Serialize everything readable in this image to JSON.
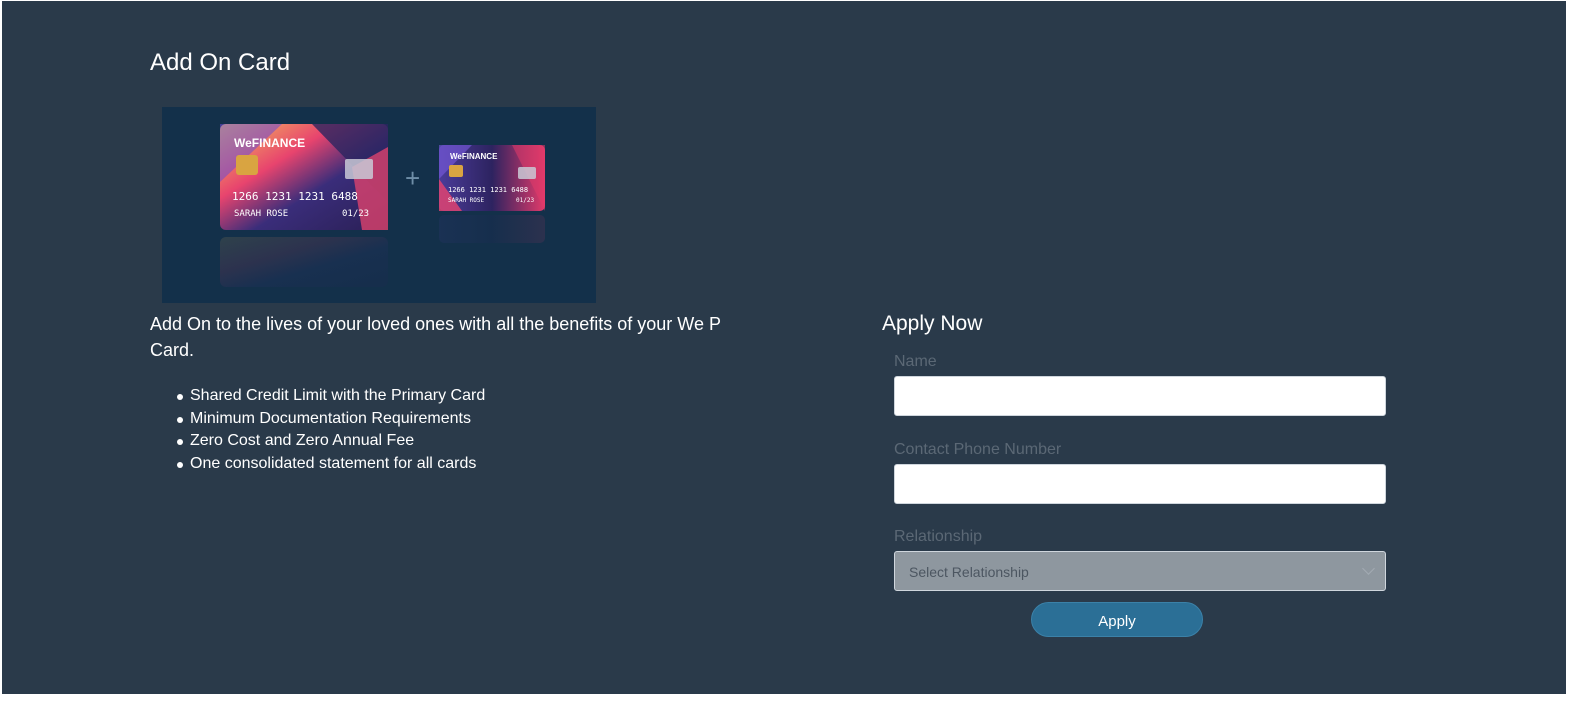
{
  "page": {
    "title": "Add On Card"
  },
  "card_image": {
    "brand": "WeFINANCE",
    "primary_card": {
      "number": "1266 1231 1231 6488",
      "holder": "SARAH ROSE",
      "expiry": "01/23"
    },
    "addon_card": {
      "number": "1266 1231 1231 6488",
      "holder": "SARAH ROSE",
      "expiry": "01/23"
    },
    "plus_sign": "+"
  },
  "intro": {
    "text": "Add On to the lives of your loved ones with all the benefits of your We P Card."
  },
  "benefits": [
    "Shared Credit Limit with the Primary Card",
    "Minimum Documentation Requirements",
    "Zero Cost and Zero Annual Fee",
    "One consolidated statement for all cards"
  ],
  "apply_form": {
    "title": "Apply Now",
    "name_label": "Name",
    "name_value": "",
    "phone_label": "Contact Phone Number",
    "phone_value": "",
    "relationship_label": "Relationship",
    "relationship_selected": "Select Relationship",
    "apply_label": "Apply"
  },
  "colors": {
    "background": "#2a3a4a",
    "image_background": "#13304a",
    "button": "#2b6f96",
    "label": "#5b6875"
  }
}
